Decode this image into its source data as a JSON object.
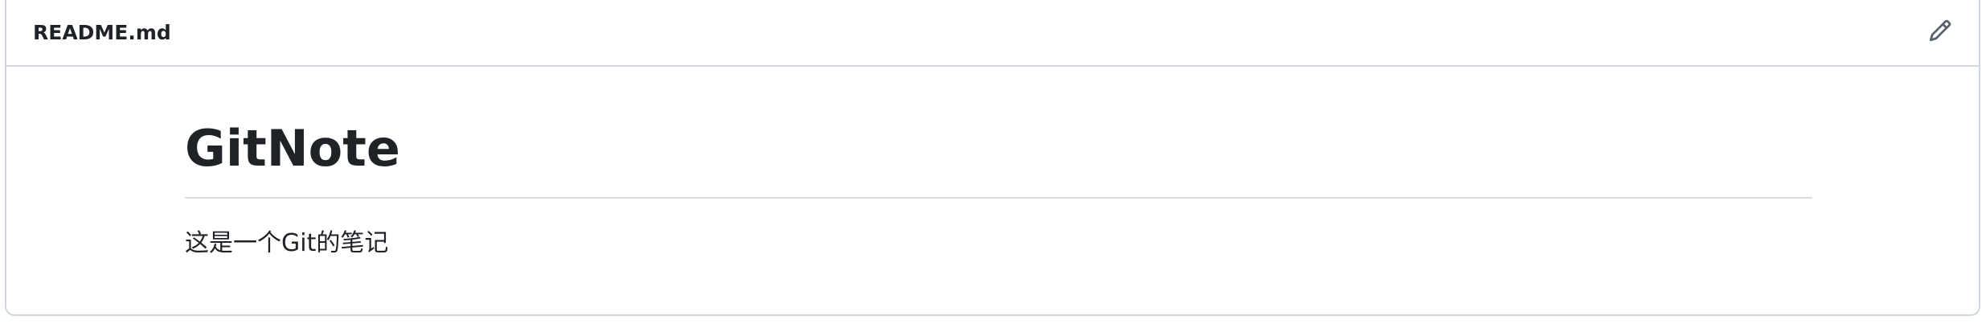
{
  "file_header": {
    "file_name": "README.md",
    "edit_icon": "pencil-icon"
  },
  "readme": {
    "title": "GitNote",
    "paragraph": "这是一个Git的笔记"
  },
  "colors": {
    "text": "#1f2328",
    "border": "#d0d7de",
    "icon": "#59636e"
  }
}
